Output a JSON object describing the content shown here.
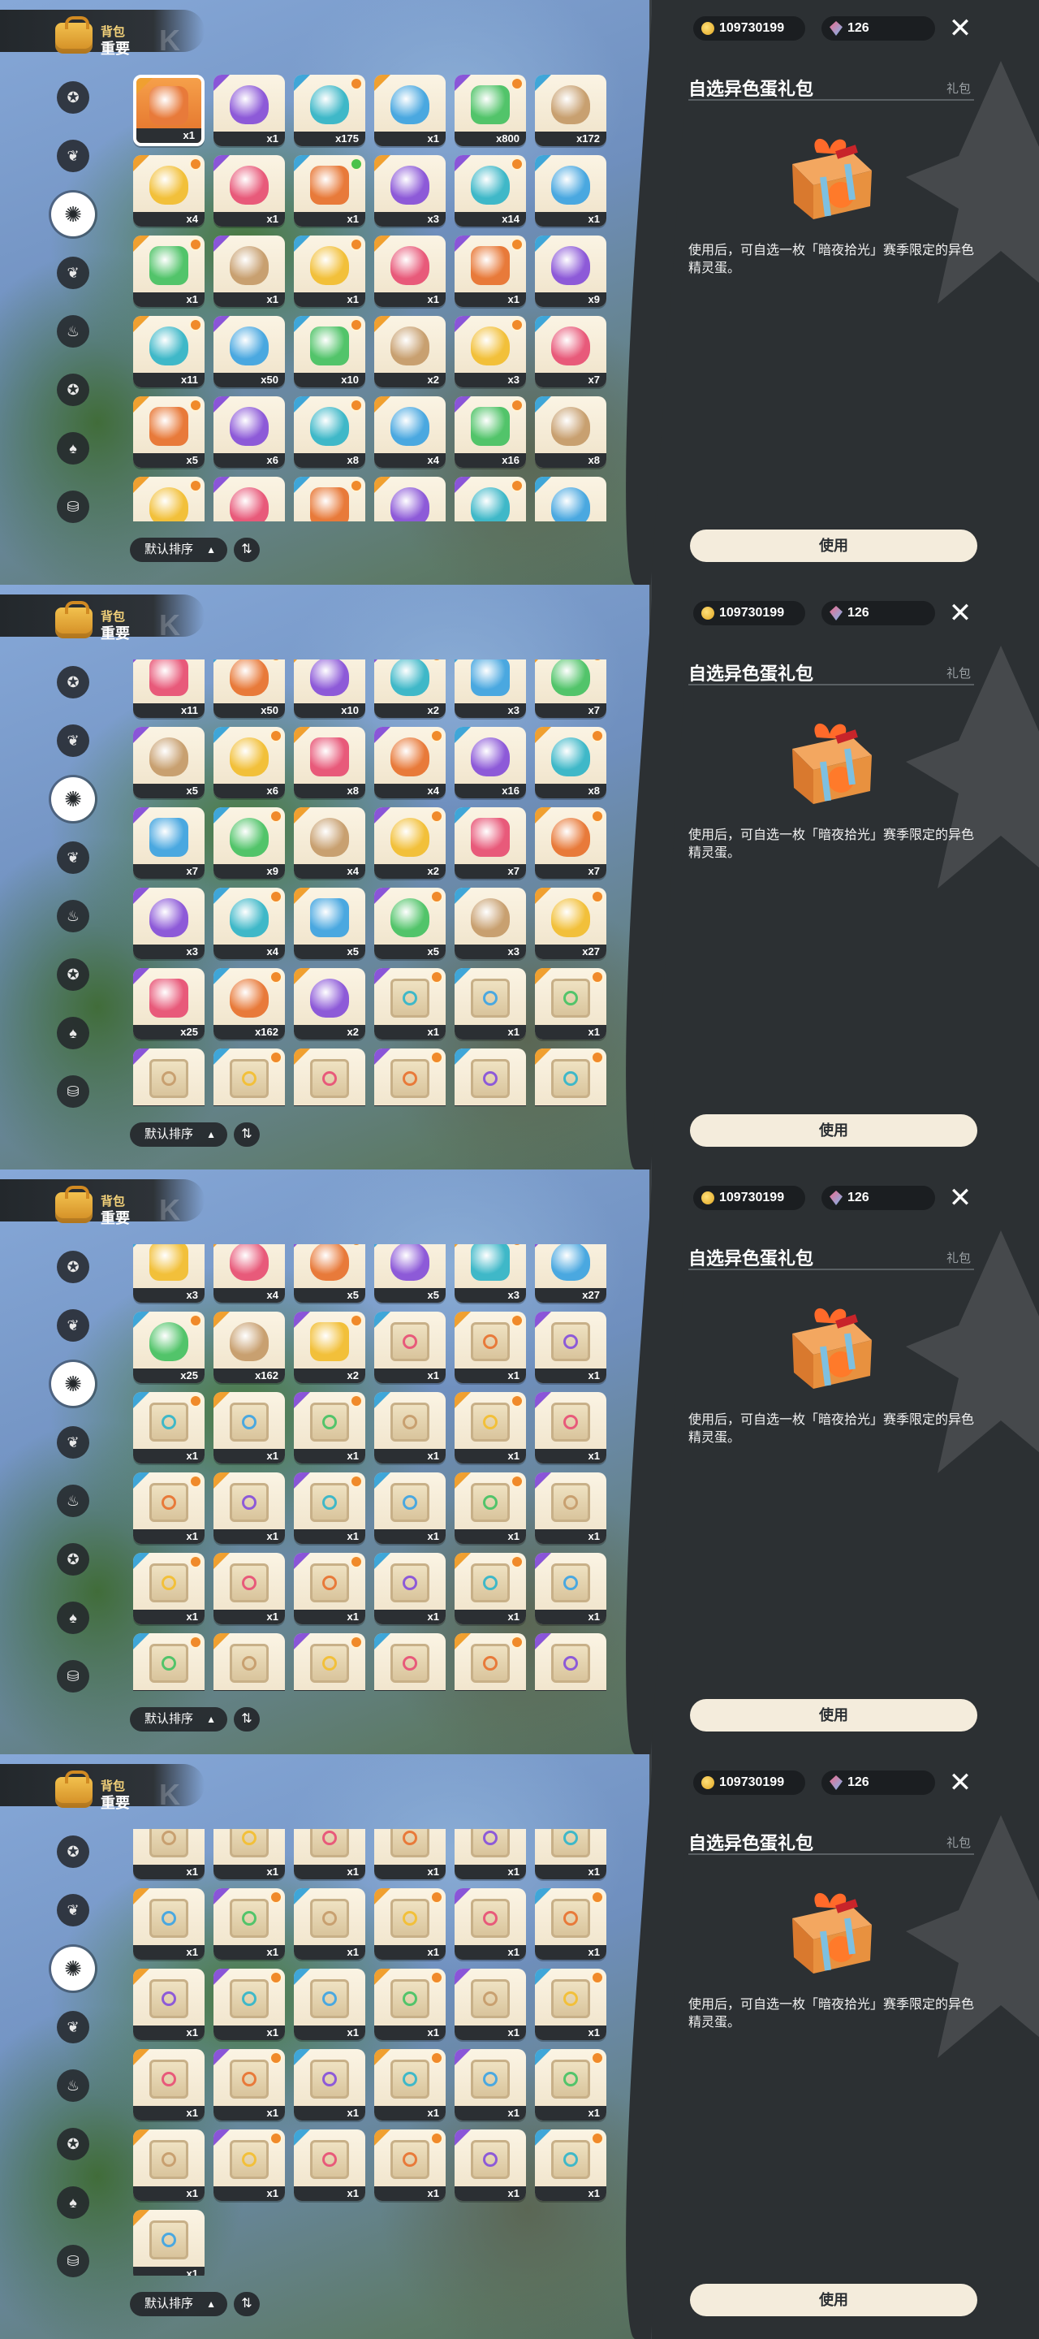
{
  "header": {
    "title": "背包",
    "subtitle": "重要"
  },
  "currency": {
    "coins": "109730199",
    "gems": "126"
  },
  "nav": [
    "star-icon",
    "leaf-icon",
    "gear-icon",
    "leaf-icon",
    "cup-icon",
    "star-icon",
    "pot-icon",
    "chest-icon"
  ],
  "sort": {
    "label": "默认排序",
    "arrow": "▲",
    "toggle": "⇅"
  },
  "detail": {
    "title": "自选异色蛋礼包",
    "category": "礼包",
    "description": "使用后，可自选一枚「暗夜拾光」赛季限定的异色精灵蛋。",
    "use_label": "使用"
  },
  "screens": [
    {
      "counts": [
        "x1",
        "x1",
        "x175",
        "x1",
        "x800",
        "x172",
        "x4",
        "x1",
        "x1",
        "x3",
        "x14",
        "x1",
        "x1",
        "x1",
        "x1",
        "x1",
        "x1",
        "x9",
        "x11",
        "x50",
        "x10",
        "x2",
        "x3",
        "x7",
        "x5",
        "x6",
        "x8",
        "x4",
        "x16",
        "x8",
        "",
        "",
        "",
        "",
        "",
        ""
      ]
    },
    {
      "counts": [
        "x11",
        "x50",
        "x10",
        "x2",
        "x3",
        "x7",
        "x5",
        "x6",
        "x8",
        "x4",
        "x16",
        "x8",
        "x7",
        "x9",
        "x4",
        "x2",
        "x7",
        "x7",
        "x3",
        "x4",
        "x5",
        "x5",
        "x3",
        "x27",
        "x25",
        "x162",
        "x2",
        "x1",
        "x1",
        "x1",
        "",
        "",
        "",
        "",
        "",
        ""
      ]
    },
    {
      "counts": [
        "x3",
        "x4",
        "x5",
        "x5",
        "x3",
        "x27",
        "x25",
        "x162",
        "x2",
        "x1",
        "x1",
        "x1",
        "x1",
        "x1",
        "x1",
        "x1",
        "x1",
        "x1",
        "x1",
        "x1",
        "x1",
        "x1",
        "x1",
        "x1",
        "x1",
        "x1",
        "x1",
        "x1",
        "x1",
        "x1",
        "x1",
        "x1",
        "x1",
        "x1",
        "x1",
        "x1"
      ]
    },
    {
      "counts": [
        "x1",
        "x1",
        "x1",
        "x1",
        "x1",
        "x1",
        "x1",
        "x1",
        "x1",
        "x1",
        "x1",
        "x1",
        "x1",
        "x1",
        "x1",
        "x1",
        "x1",
        "x1",
        "x1",
        "x1",
        "x1",
        "x1",
        "x1",
        "x1",
        "x1",
        "x1",
        "x1",
        "x1",
        "x1",
        "x1",
        "x1"
      ]
    }
  ],
  "colors": {
    "panel_bg": "#2c3033",
    "item_bg": "#fbf4e4",
    "accent_orange": "#f0a030",
    "accent_purple": "#8a55d8",
    "accent_blue": "#3fa6d8",
    "button_bg": "#f4ecdc"
  }
}
